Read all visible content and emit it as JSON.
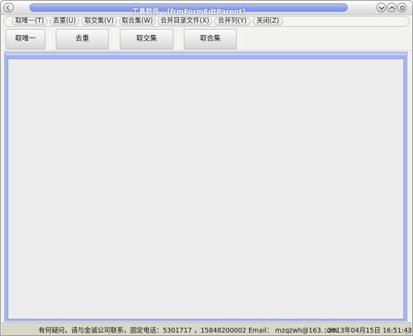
{
  "window": {
    "title": "工具软件 - [frmFormEdtParent]"
  },
  "menu": {
    "items": [
      {
        "label": "取唯一(T)"
      },
      {
        "label": "去重(U)"
      },
      {
        "label": "取交集(V)"
      },
      {
        "label": "取合集(W)"
      },
      {
        "label": "合并目录文件(X)"
      },
      {
        "label": "合并列(Y)"
      },
      {
        "label": "关闭(Z)"
      }
    ]
  },
  "toolbar": {
    "buttons": [
      {
        "label": "取唯一"
      },
      {
        "label": "去重"
      },
      {
        "label": "取交集"
      },
      {
        "label": "取合集"
      }
    ]
  },
  "status": {
    "contact": "有何疑问，请与金诚公司联系，固定电话：5301717 ，15848200002 Email： mzqzwh@163.com",
    "datetime": "2013年04月15日  16:51:43"
  },
  "icons": {
    "system": "system-menu-icon",
    "minimize": "minimize-icon",
    "maximize": "maximize-icon",
    "close": "close-icon",
    "grip": "resize-grip-icon"
  },
  "colors": {
    "title_pill": "#8d9ff0",
    "client_border": "#a9b6ec",
    "client_bg": "#ececec",
    "statusbar_bg": "#d8d8c8"
  }
}
